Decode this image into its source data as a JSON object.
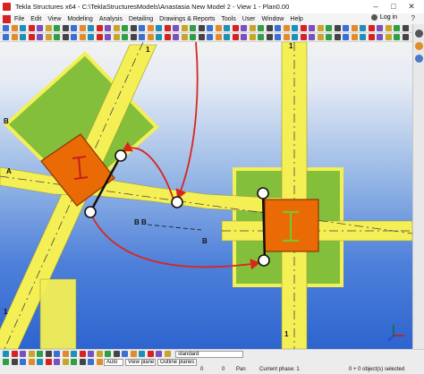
{
  "titlebar": {
    "title": "Tekla Structures x64 - C:\\TeklaStructuresModels\\Anastasia New Model 2 - View 1 - Plan0.00",
    "minimize": "–",
    "maximize": "□",
    "close": "✕"
  },
  "menu": {
    "items": [
      "File",
      "Edit",
      "View",
      "Modeling",
      "Analysis",
      "Detailing",
      "Drawings & Reports",
      "Tools",
      "User",
      "Window",
      "Help"
    ],
    "login": "Log in",
    "help_icon": "?"
  },
  "viewport": {
    "grid_labels": {
      "top_1": "1",
      "top_2": "1",
      "left_b": "B",
      "left_a": "A",
      "right_b": "B",
      "bottom_1a": "1",
      "bottom_1b": "1"
    },
    "section_cut_label": "B B",
    "section_label_b": "B",
    "axis_icon": "axes-icon"
  },
  "bottom_toolbar": {
    "select_value": "standard"
  },
  "select_bar": {
    "auto": "Auto",
    "view_plane": "View plane",
    "outline_planes": "Outline planes"
  },
  "statusbar": {
    "zero1": "0",
    "zero2": "0",
    "pan": "Pan",
    "phase": "Current phase: 1",
    "selected": "0 + 0 object(s) selected"
  },
  "colors": {
    "footing_green": "#84bf3c",
    "beam_yellow": "#f4ef55",
    "column_orange": "#ea6a06",
    "annotation_red": "#d8261f",
    "viewport_blue": "#3a6fd4"
  }
}
